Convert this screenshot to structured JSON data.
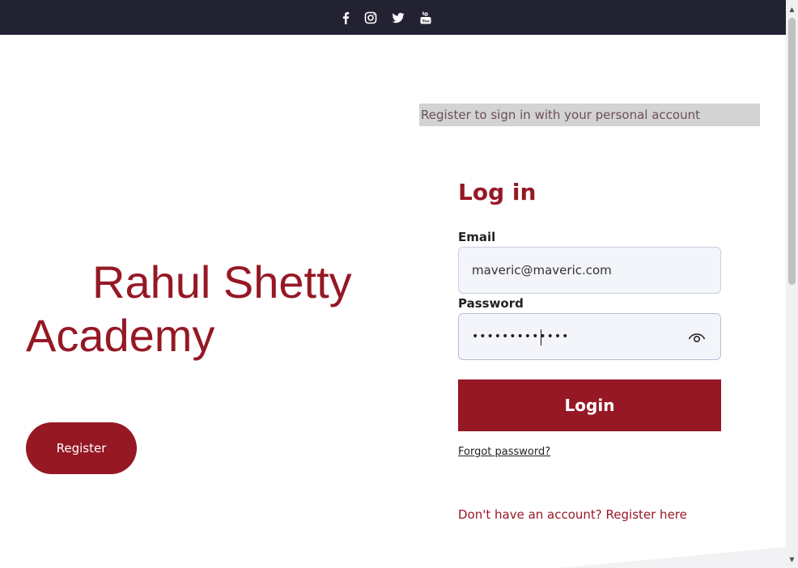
{
  "header": {
    "social_icons": [
      "facebook-icon",
      "instagram-icon",
      "twitter-icon",
      "youtube-icon"
    ],
    "background": "#222233"
  },
  "branding": {
    "line1": "Rahul Shetty",
    "line2": "Academy",
    "register_label": "Register",
    "accent_color": "#961825"
  },
  "login": {
    "banner": "Register to sign in with your personal account",
    "title": "Log in",
    "email_label": "Email",
    "email_value": "maveric@maveric.com",
    "password_label": "Password",
    "password_mask": "•••••••••••••",
    "login_label": "Login",
    "forgot_label": "Forgot password?",
    "signup_label": "Don't have an account? Register here"
  }
}
